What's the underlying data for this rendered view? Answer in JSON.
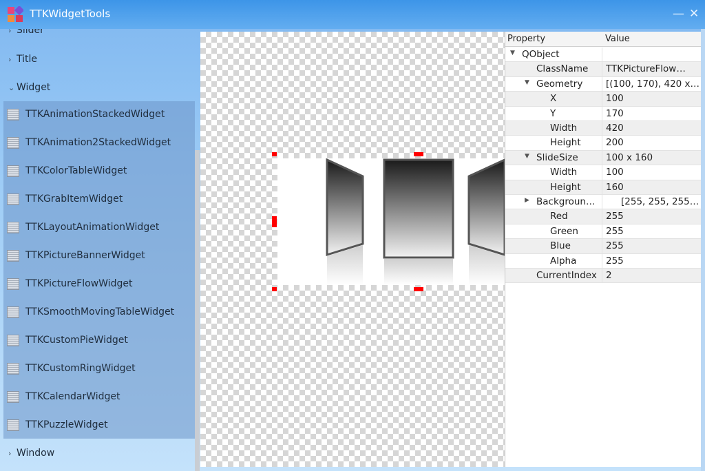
{
  "window": {
    "title": "TTKWidgetTools",
    "min_label": "—",
    "close_label": "✕"
  },
  "sidebar": {
    "top_partial": "Slider",
    "categories": [
      {
        "label": "Title",
        "chevron": "›"
      },
      {
        "label": "Widget",
        "chevron": "⌄"
      },
      {
        "label": "Window",
        "chevron": "›"
      }
    ],
    "items": [
      "TTKAnimationStackedWidget",
      "TTKAnimation2StackedWidget",
      "TTKColorTableWidget",
      "TTKGrabItemWidget",
      "TTKLayoutAnimationWidget",
      "TTKPictureBannerWidget",
      "TTKPictureFlowWidget",
      "TTKSmoothMovingTableWidget",
      "TTKCustomPieWidget",
      "TTKCustomRingWidget",
      "TTKCalendarWidget",
      "TTKPuzzleWidget"
    ]
  },
  "props": {
    "header": {
      "property": "Property",
      "value": "Value"
    },
    "rows": [
      {
        "name": "QObject",
        "value": "",
        "level": 0,
        "toggle": "▼"
      },
      {
        "name": "ClassName",
        "value": "TTKPictureFlow…",
        "level": 1,
        "toggle": ""
      },
      {
        "name": "Geometry",
        "value": "[(100, 170), 420 x…",
        "level": 1,
        "toggle": "▼"
      },
      {
        "name": "X",
        "value": "100",
        "level": 2,
        "toggle": ""
      },
      {
        "name": "Y",
        "value": "170",
        "level": 2,
        "toggle": ""
      },
      {
        "name": "Width",
        "value": "420",
        "level": 2,
        "toggle": ""
      },
      {
        "name": "Height",
        "value": "200",
        "level": 2,
        "toggle": ""
      },
      {
        "name": "SlideSize",
        "value": "100 x 160",
        "level": 1,
        "toggle": "▼"
      },
      {
        "name": "Width",
        "value": "100",
        "level": 2,
        "toggle": ""
      },
      {
        "name": "Height",
        "value": "160",
        "level": 2,
        "toggle": ""
      },
      {
        "name": "Backgroun…",
        "value": "[255, 255, 255…",
        "level": 1,
        "toggle": "▶",
        "swatch": "#ffffff"
      },
      {
        "name": "Red",
        "value": "255",
        "level": 2,
        "toggle": ""
      },
      {
        "name": "Green",
        "value": "255",
        "level": 2,
        "toggle": ""
      },
      {
        "name": "Blue",
        "value": "255",
        "level": 2,
        "toggle": ""
      },
      {
        "name": "Alpha",
        "value": "255",
        "level": 2,
        "toggle": ""
      },
      {
        "name": "CurrentIndex",
        "value": "2",
        "level": 1,
        "toggle": ""
      }
    ]
  },
  "colors": {
    "accent": "#3d95e8",
    "handle": "#ff0000"
  }
}
